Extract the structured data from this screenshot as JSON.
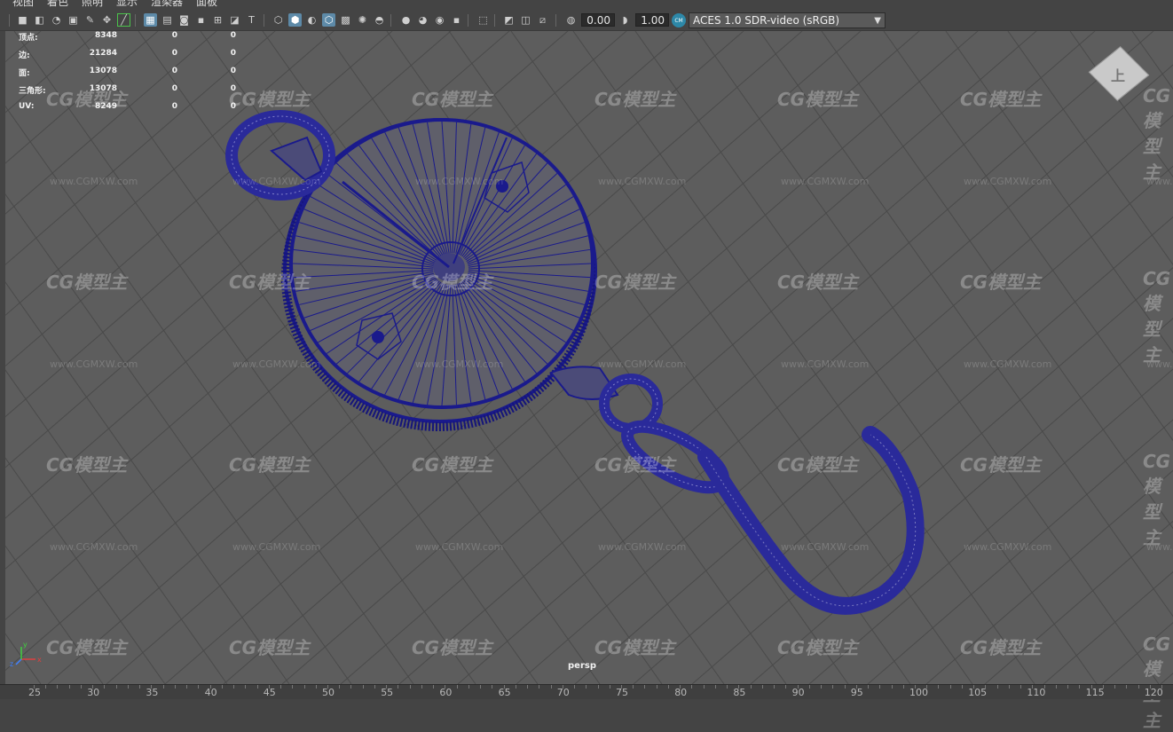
{
  "menu": [
    "视图",
    "着色",
    "照明",
    "显示",
    "渲染器",
    "面板"
  ],
  "toolbar": {
    "icons": [
      "camera-icon",
      "camera-attribute-icon",
      "bookmark-icon",
      "image-plane-icon",
      "grease-pencil-icon",
      "2d-pan-icon",
      "xray-icon",
      "grid-icon",
      "film-gate-icon",
      "resolution-gate-icon",
      "gate-mask-icon",
      "field-chart-icon",
      "safe-action-icon",
      "safe-title-icon",
      "wireframe-icon",
      "smooth-shade-icon",
      "default-material-icon",
      "wireframe-on-shaded-icon",
      "textured-icon",
      "use-all-lights-icon",
      "shadows-icon",
      "screen-space-ao-icon",
      "motion-blur-icon",
      "multisample-aa-icon",
      "depth-of-field-icon",
      "isolate-select-icon",
      "xray-joints-icon",
      "xray-active-components-icon",
      "backface-culling-icon",
      "exposure-icon",
      "gamma-icon"
    ],
    "exposure_value": "0.00",
    "gamma_value": "1.00",
    "color_management": "ACES 1.0 SDR-video (sRGB)",
    "cm_badge": "CM"
  },
  "hud": {
    "rows": [
      {
        "label": "顶点:",
        "v1": "8348",
        "v2": "0",
        "v3": "0"
      },
      {
        "label": "边:",
        "v1": "21284",
        "v2": "0",
        "v3": "0"
      },
      {
        "label": "面:",
        "v1": "13078",
        "v2": "0",
        "v3": "0"
      },
      {
        "label": "三角形:",
        "v1": "13078",
        "v2": "0",
        "v3": "0"
      },
      {
        "label": "UV:",
        "v1": "8249",
        "v2": "0",
        "v3": "0"
      }
    ]
  },
  "viewcube_label": "上",
  "camera_label": "persp",
  "axis_labels": {
    "x": "x",
    "y": "y",
    "z": "z"
  },
  "watermark": {
    "logo": "CG模型主",
    "url": "www.CGMXW.com"
  },
  "colors": {
    "viewport_bg": "#5d5d5d",
    "wireframe": "#1a1a8c",
    "grid": "#4a4a4a",
    "ui_bg": "#444444",
    "accent": "#5d8aa8"
  },
  "ruler": {
    "ticks": [
      "25",
      "30",
      "35",
      "40",
      "45",
      "50",
      "55",
      "60",
      "65",
      "70",
      "75",
      "80",
      "85",
      "90",
      "95",
      "100",
      "105",
      "110",
      "115",
      "120"
    ]
  }
}
